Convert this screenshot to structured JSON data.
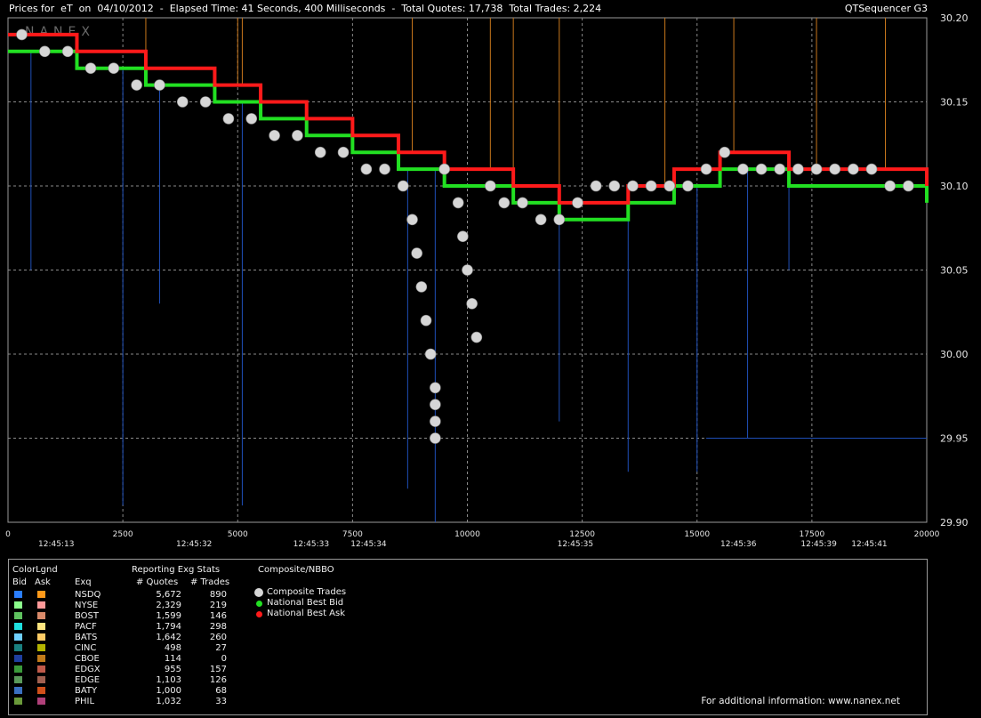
{
  "header": {
    "title": "Prices for  eT  on  04/10/2012  -  Elapsed Time: 41 Seconds, 400 Milliseconds  -  Total Quotes: 17,738  Total Trades: 2,224",
    "app": "QTSequencer G3",
    "watermark": "NANEX"
  },
  "colors": {
    "background": "#000000",
    "grid": "#9a9a9a",
    "trade_dot": "#d6d6d6",
    "national_best_bid": "#22e022",
    "national_best_ask": "#ff1a1a",
    "ask_lines": "#c8771c",
    "bid_lines": "#1f4fb8"
  },
  "chart_data": {
    "type": "line",
    "title": "",
    "xlabel": "",
    "ylabel": "",
    "xlim": [
      0,
      20000
    ],
    "ylim": [
      29.9,
      30.2
    ],
    "grid": true,
    "y_ticks": [
      "30.20",
      "30.15",
      "30.10",
      "30.05",
      "30.00",
      "29.95",
      "29.90"
    ],
    "x_ticks": [
      "0",
      "2500",
      "5000",
      "7500",
      "10000",
      "12500",
      "15000",
      "17500",
      "20000"
    ],
    "time_labels": [
      {
        "x": 1050,
        "label": "12:45:13"
      },
      {
        "x": 4050,
        "label": "12:45:32"
      },
      {
        "x": 6600,
        "label": "12:45:33"
      },
      {
        "x": 7850,
        "label": "12:45:34"
      },
      {
        "x": 12350,
        "label": "12:45:35"
      },
      {
        "x": 15900,
        "label": "12:45:36"
      },
      {
        "x": 17650,
        "label": "12:45:39"
      },
      {
        "x": 18750,
        "label": "12:45:41"
      }
    ],
    "series": [
      {
        "name": "National Best Bid",
        "x": [
          0,
          500,
          1000,
          1500,
          2000,
          2500,
          3000,
          3500,
          4000,
          4500,
          5000,
          5500,
          6000,
          6500,
          7000,
          7500,
          8000,
          8500,
          9000,
          9500,
          10000,
          10500,
          11000,
          11500,
          12000,
          12500,
          13000,
          13500,
          14000,
          14500,
          15000,
          15500,
          16000,
          16500,
          17000,
          17500,
          18000,
          18500,
          19000,
          19500,
          20000
        ],
        "y": [
          30.18,
          30.18,
          30.18,
          30.17,
          30.17,
          30.17,
          30.16,
          30.16,
          30.16,
          30.15,
          30.15,
          30.14,
          30.14,
          30.13,
          30.13,
          30.12,
          30.12,
          30.11,
          30.11,
          30.1,
          30.1,
          30.1,
          30.09,
          30.09,
          30.08,
          30.08,
          30.08,
          30.09,
          30.09,
          30.1,
          30.1,
          30.11,
          30.11,
          30.11,
          30.1,
          30.1,
          30.1,
          30.1,
          30.1,
          30.1,
          30.09
        ]
      },
      {
        "name": "National Best Ask",
        "x": [
          0,
          500,
          1000,
          1500,
          2000,
          2500,
          3000,
          3500,
          4000,
          4500,
          5000,
          5500,
          6000,
          6500,
          7000,
          7500,
          8000,
          8500,
          9000,
          9500,
          10000,
          10500,
          11000,
          11500,
          12000,
          12500,
          13000,
          13500,
          14000,
          14500,
          15000,
          15500,
          16000,
          16500,
          17000,
          17500,
          18000,
          18500,
          19000,
          19500,
          20000
        ],
        "y": [
          30.19,
          30.19,
          30.19,
          30.18,
          30.18,
          30.18,
          30.17,
          30.17,
          30.17,
          30.16,
          30.16,
          30.15,
          30.15,
          30.14,
          30.14,
          30.13,
          30.13,
          30.12,
          30.12,
          30.11,
          30.11,
          30.11,
          30.1,
          30.1,
          30.09,
          30.09,
          30.09,
          30.1,
          30.1,
          30.11,
          30.11,
          30.12,
          30.12,
          30.12,
          30.11,
          30.11,
          30.11,
          30.11,
          30.11,
          30.11,
          30.1
        ]
      },
      {
        "name": "Composite Trades",
        "x": [
          300,
          800,
          1300,
          1800,
          2300,
          2800,
          3300,
          3800,
          4300,
          4800,
          5300,
          5800,
          6300,
          6800,
          7300,
          7800,
          8200,
          8600,
          8800,
          8900,
          9000,
          9100,
          9200,
          9300,
          9300,
          9300,
          9300,
          9500,
          9800,
          9900,
          10000,
          10100,
          10200,
          10500,
          10800,
          11200,
          11600,
          12000,
          12400,
          12800,
          13200,
          13600,
          14000,
          14400,
          14800,
          15200,
          15600,
          16000,
          16400,
          16800,
          17200,
          17600,
          18000,
          18400,
          18800,
          19200,
          19600
        ],
        "y": [
          30.19,
          30.18,
          30.18,
          30.17,
          30.17,
          30.16,
          30.16,
          30.15,
          30.15,
          30.14,
          30.14,
          30.13,
          30.13,
          30.12,
          30.12,
          30.11,
          30.11,
          30.1,
          30.08,
          30.06,
          30.04,
          30.02,
          30.0,
          29.98,
          29.97,
          29.96,
          29.95,
          30.11,
          30.09,
          30.07,
          30.05,
          30.03,
          30.01,
          30.1,
          30.09,
          30.09,
          30.08,
          30.08,
          30.09,
          30.1,
          30.1,
          30.1,
          30.1,
          30.1,
          30.1,
          30.11,
          30.12,
          30.11,
          30.11,
          30.11,
          30.11,
          30.11,
          30.11,
          30.11,
          30.11,
          30.1,
          30.1
        ]
      }
    ]
  },
  "legend": {
    "color_legend_header": "ColorLgnd",
    "bid_header": "Bid",
    "ask_header": "Ask",
    "exchange_header": "Exq",
    "stats_header": "Reporting Exg Stats",
    "quotes_header": "# Quotes",
    "trades_header": "# Trades",
    "composite_header": "Composite/NBBO",
    "rows": [
      {
        "exchange": "NSDQ",
        "quotes": "5,672",
        "trades": "890",
        "bid_color": "#2b7fff",
        "ask_color": "#ff9a1a"
      },
      {
        "exchange": "NYSE",
        "quotes": "2,329",
        "trades": "219",
        "bid_color": "#8cff8c",
        "ask_color": "#ff9a9a"
      },
      {
        "exchange": "BOST",
        "quotes": "1,599",
        "trades": "146",
        "bid_color": "#5fc25f",
        "ask_color": "#d98a6a"
      },
      {
        "exchange": "PACF",
        "quotes": "1,794",
        "trades": "298",
        "bid_color": "#1fe0e0",
        "ask_color": "#ffe680"
      },
      {
        "exchange": "BATS",
        "quotes": "1,642",
        "trades": "260",
        "bid_color": "#6fd0ff",
        "ask_color": "#ffcc66"
      },
      {
        "exchange": "CINC",
        "quotes": "498",
        "trades": "27",
        "bid_color": "#1a8080",
        "ask_color": "#b4b400"
      },
      {
        "exchange": "CBOE",
        "quotes": "114",
        "trades": "0",
        "bid_color": "#1f3fa0",
        "ask_color": "#c07a1a"
      },
      {
        "exchange": "EDGX",
        "quotes": "955",
        "trades": "157",
        "bid_color": "#3a9a3a",
        "ask_color": "#c05a4a"
      },
      {
        "exchange": "EDGE",
        "quotes": "1,103",
        "trades": "126",
        "bid_color": "#5a9a5a",
        "ask_color": "#a06050"
      },
      {
        "exchange": "BATY",
        "quotes": "1,000",
        "trades": "68",
        "bid_color": "#3a70c0",
        "ask_color": "#d0501a"
      },
      {
        "exchange": "PHIL",
        "quotes": "1,032",
        "trades": "33",
        "bid_color": "#6a9a3a",
        "ask_color": "#b0407a"
      }
    ],
    "composite_items": [
      {
        "label": "Composite Trades",
        "color": "#d6d6d6"
      },
      {
        "label": "National Best Bid",
        "color": "#22e022"
      },
      {
        "label": "National Best Ask",
        "color": "#ff1a1a"
      }
    ],
    "footer": "For additional information: www.nanex.net"
  }
}
